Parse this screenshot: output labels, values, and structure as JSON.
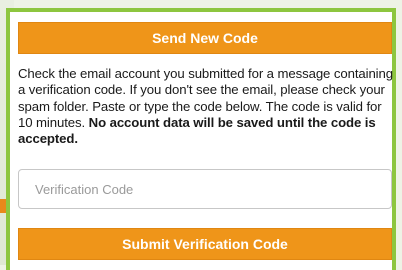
{
  "buttons": {
    "send_new_code": "Send New Code",
    "submit_code": "Submit Verification Code"
  },
  "message": {
    "text": "Check the email account you submitted for a message containing a verification code. If you don't see the email, please check your spam folder. Paste or type the code below. The code is valid for 10 minutes.",
    "emphasis": "No account data will be saved until the code is accepted."
  },
  "verification_input": {
    "placeholder": "Verification Code",
    "value": ""
  },
  "colors": {
    "accent_orange": "#ef9519",
    "panel_border_green": "#8dc63f"
  }
}
